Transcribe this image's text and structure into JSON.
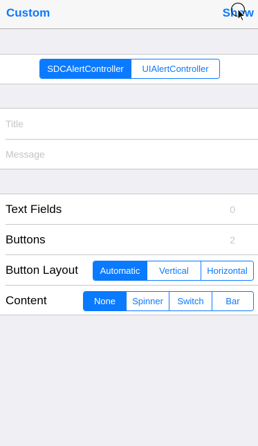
{
  "nav": {
    "left_label": "Custom",
    "right_label": "Show"
  },
  "controller_picker": {
    "options": [
      "SDCAlertController",
      "UIAlertController"
    ],
    "selected": "SDCAlertController"
  },
  "fields": {
    "title_placeholder": "Title",
    "message_placeholder": "Message"
  },
  "settings": {
    "text_fields": {
      "label": "Text Fields",
      "value": "0"
    },
    "buttons": {
      "label": "Buttons",
      "value": "2"
    },
    "button_layout": {
      "label": "Button Layout",
      "options": [
        "Automatic",
        "Vertical",
        "Horizontal"
      ],
      "selected": "Automatic"
    },
    "content": {
      "label": "Content",
      "options": [
        "None",
        "Spinner",
        "Switch",
        "Bar"
      ],
      "selected": "None"
    }
  },
  "colors": {
    "accent": "#0a7aff",
    "background": "#efeff4",
    "separator": "#c8c7cc"
  }
}
